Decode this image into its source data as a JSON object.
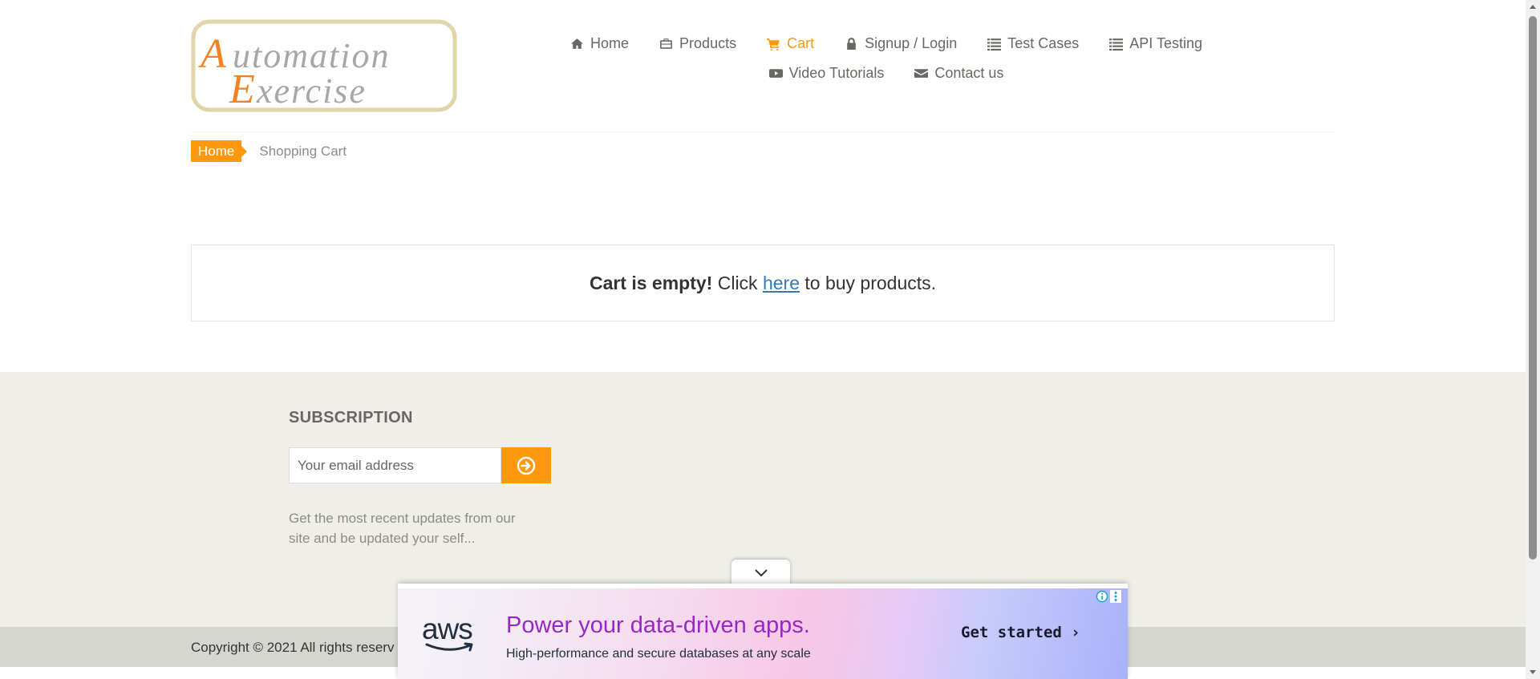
{
  "logo": {
    "line1": "Automation",
    "line2": "Exercise"
  },
  "nav": {
    "row1": [
      {
        "label": "Home",
        "icon": "home-icon"
      },
      {
        "label": "Products",
        "icon": "briefcase-icon"
      },
      {
        "label": "Cart",
        "icon": "cart-icon",
        "active": true
      },
      {
        "label": "Signup / Login",
        "icon": "lock-icon"
      },
      {
        "label": "Test Cases",
        "icon": "list-icon"
      },
      {
        "label": "API Testing",
        "icon": "list-icon"
      }
    ],
    "row2": [
      {
        "label": "Video Tutorials",
        "icon": "youtube-play-icon"
      },
      {
        "label": "Contact us",
        "icon": "envelope-icon"
      }
    ]
  },
  "breadcrumb": {
    "home": "Home",
    "current": "Shopping Cart"
  },
  "cart": {
    "empty_bold": "Cart is empty!",
    "click": "Click",
    "link": "here",
    "rest": "to buy products."
  },
  "subscription": {
    "title": "SUBSCRIPTION",
    "placeholder": "Your email address",
    "button_icon": "arrow-circle-right-icon",
    "description": "Get the most recent updates from our site and be updated your self..."
  },
  "footer": {
    "copyright": "Copyright © 2021 All rights reserv"
  },
  "ad": {
    "brand": "aws",
    "headline": "Power your data-driven apps.",
    "subline": "High-performance and secure databases at any scale",
    "cta": "Get started ›"
  },
  "colors": {
    "accent": "#fe980f",
    "link": "#337ab7",
    "footer_bg": "#efeee8",
    "ad_headline": "#9b25c9"
  }
}
